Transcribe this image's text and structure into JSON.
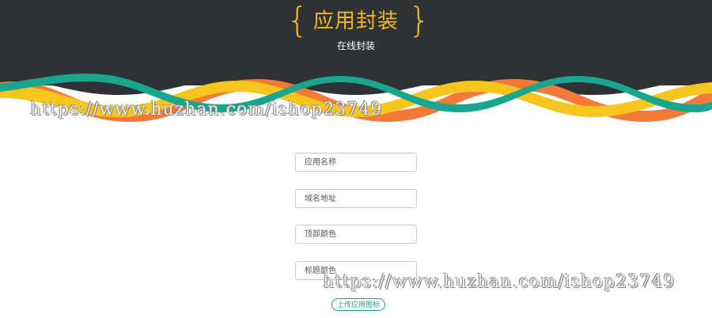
{
  "header": {
    "title": "应用封装",
    "subtitle": "在线封装",
    "brace_left": "{",
    "brace_right": "}"
  },
  "watermark": {
    "text_top": "https://www.huzhan.com/ishop23749",
    "text_bottom": "https://www.huzhan.com/ishop23749"
  },
  "form": {
    "app_name_placeholder": "应用名称",
    "domain_placeholder": "域名地址",
    "top_color_placeholder": "顶部颜色",
    "title_color_placeholder": "标题颜色",
    "upload_label": "上传应用图标"
  },
  "colors": {
    "header_bg": "#2e3235",
    "wave_teal": "#1aa58f",
    "wave_yellow": "#f6c61e",
    "wave_orange": "#f27a36",
    "title": "#f2b81d"
  }
}
